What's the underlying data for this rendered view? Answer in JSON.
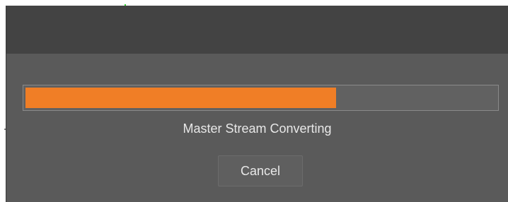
{
  "dialog": {
    "title": "",
    "progress": {
      "percent": 66
    },
    "status_text": "Master Stream Converting",
    "cancel_label": "Cancel"
  },
  "colors": {
    "progress_fill": "#f07e26",
    "dialog_background": "#5a5a5a",
    "titlebar_background": "#434343"
  }
}
